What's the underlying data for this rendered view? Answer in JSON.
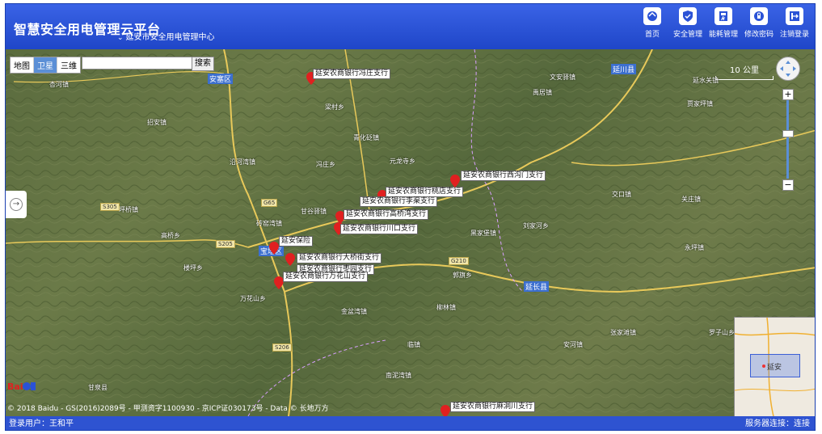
{
  "header": {
    "app_title": "智慧安全用电管理云平台",
    "org_selector": "延安市安全用电管理中心",
    "nav": [
      {
        "label": "首页",
        "icon": "home-icon"
      },
      {
        "label": "安全管理",
        "icon": "shield-icon"
      },
      {
        "label": "能耗管理",
        "icon": "energy-meter-icon"
      },
      {
        "label": "修改密码",
        "icon": "lock-icon"
      },
      {
        "label": "注销登录",
        "icon": "logout-icon"
      }
    ]
  },
  "map": {
    "map_types": [
      "地图",
      "卫星",
      "三维"
    ],
    "active_map_type": "卫星",
    "search": {
      "value": "",
      "button": "搜索"
    },
    "scale_label": "10 公里",
    "copyright": "© 2018 Baidu - GS(2016)2089号 - 甲测资字1100930 - 京ICP证030173号 - Data © 长地万方",
    "districts": [
      "安塞区",
      "延川县",
      "延长县",
      "宝塔区"
    ],
    "places": [
      "杏河镇",
      "招安镇",
      "沿河湾镇",
      "坪桥镇",
      "砖窑湾镇",
      "高桥乡",
      "楼坪乡",
      "万花山乡",
      "元龙寺乡",
      "冯庄乡",
      "梁村乡",
      "青化砭镇",
      "甘谷驿镇",
      "交口镇",
      "刘家河乡",
      "黑家堡镇",
      "郭旗乡",
      "柳林镇",
      "金盆湾镇",
      "临镇",
      "南泥湾镇",
      "关庄镇",
      "永坪镇",
      "贾家坪镇",
      "文安驿镇",
      "禹居镇",
      "罗子山乡",
      "安河镇",
      "张家滩镇",
      "甘泉县",
      "延水关镇"
    ],
    "roads": [
      "G65",
      "S205",
      "S206",
      "G210",
      "S305"
    ],
    "markers": [
      {
        "label": "延安农商银行冯庄支行"
      },
      {
        "label": "延安农商银行桃店支行"
      },
      {
        "label": "延安农商银行李渠支行"
      },
      {
        "label": "延安农商银行西沟门支行"
      },
      {
        "label": "延安农商银行高桥湾支行"
      },
      {
        "label": "延安农商银行川口支行"
      },
      {
        "label": "延安农商银行大桥街支行"
      },
      {
        "label": "延安农商银行万花山支行"
      },
      {
        "label": "延安农商银行麻洞川支行"
      },
      {
        "label": "延安农商银行枣园支行"
      },
      {
        "label": "延安保险"
      }
    ],
    "minimap_city": "延安"
  },
  "footer": {
    "user": "登录用户：王和平",
    "status": "服务器连接：连接"
  },
  "colors": {
    "header_blue": "#2a52d6",
    "footer_blue": "#2e53d1",
    "marker_red": "#e02020"
  }
}
